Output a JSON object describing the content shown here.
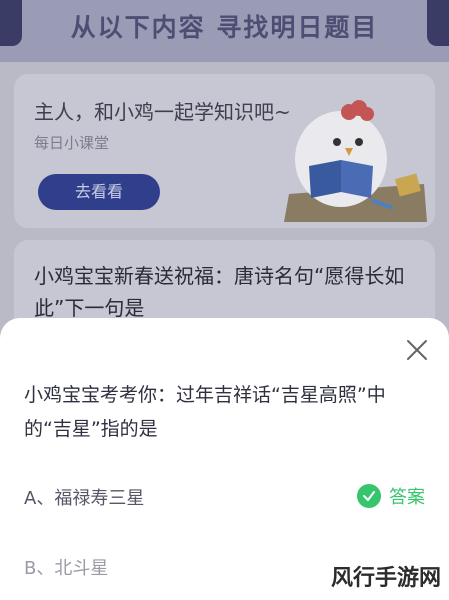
{
  "banner": {
    "title": "从以下内容 寻找明日题目"
  },
  "card1": {
    "title": "主人，和小鸡一起学知识吧~",
    "subtitle": "每日小课堂",
    "button_label": "去看看"
  },
  "card2": {
    "title": "小鸡宝宝新春送祝福：唐诗名句“愿得长如此”下一句是"
  },
  "sheet": {
    "question": "小鸡宝宝考考你：过年吉祥话“吉星高照”中的“吉星”指的是",
    "options": [
      {
        "label": "A、福禄寿三星",
        "answer_label": "答案"
      },
      {
        "label": "B、北斗星"
      }
    ]
  },
  "watermark": "风行手游网",
  "colors": {
    "accent_green": "#35c56c",
    "button_blue": "#2f3f8b"
  }
}
